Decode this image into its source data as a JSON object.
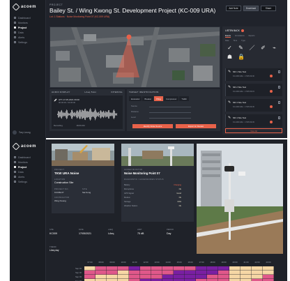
{
  "sidebar_top": {
    "brand": "acoem",
    "items": [
      {
        "label": "Dashboard",
        "active": false
      },
      {
        "label": "Monitors",
        "active": false
      },
      {
        "label": "Project",
        "active": true
      },
      {
        "label": "Data",
        "active": false
      },
      {
        "label": "Alerts",
        "active": false
      },
      {
        "label": "Settings",
        "active": false
      }
    ],
    "user": "Tony Leung"
  },
  "sidebar_bottom": {
    "brand": "acoem",
    "items": [
      {
        "label": "Dashboard",
        "active": false
      },
      {
        "label": "Monitors",
        "active": false
      },
      {
        "label": "Project",
        "active": true
      },
      {
        "label": "Data",
        "active": false
      },
      {
        "label": "Alerts",
        "active": false
      },
      {
        "label": "Settings",
        "active": false
      }
    ]
  },
  "header": {
    "crumb": "PROJECT",
    "title": "Bailey St. / Wing Kwong St. Development Project (KC-009 URA)",
    "subtitle": "Lot: 1 Stations · Noise Monitoring Point 07 (KC-009 URA)",
    "buttons": [
      "Add Note",
      "Download",
      "Share"
    ]
  },
  "audio": {
    "title": "AUDIO DISPLAY",
    "col2": "LAeq 5min",
    "col3": "INTERVAL",
    "clip_label": "ATT-17-05-2021 09:00",
    "clip_sub": "00:00:00 / 00:05:00",
    "foot_left": "Recording",
    "foot_right": "09:00 AM"
  },
  "target": {
    "title": "TARGET IDENTIFICATION",
    "tabs": [
      "Excavator",
      "Breaker",
      "Piling",
      "Compressor",
      "Traffic"
    ],
    "active_tab": 2,
    "fields": [
      "Source",
      "Distance",
      "Level"
    ],
    "buttons": [
      "Identify Noise Source",
      "Export for Review"
    ]
  },
  "listen": {
    "title": "LISTEN BACK",
    "tabs": [
      "Events",
      "Annotations",
      "Exports"
    ],
    "sub_tabs": [
      "Date",
      "Time",
      "Type"
    ],
    "tools": [
      "✓",
      "✎",
      "／",
      "✐",
      "⌁",
      "☗",
      "🔒"
    ],
    "entries": [
      {
        "title": "NR 1 Site Test",
        "sub": "KC-009 URA · 17/05 09:00"
      },
      {
        "title": "NR 2 Site Test",
        "sub": "KC-009 URA · 17/05 09:15"
      },
      {
        "title": "NR 3 Site Test",
        "sub": "KC-009 URA · 17/05 09:30"
      },
      {
        "title": "NR 4 Site Test",
        "sub": "KC-009 URA · 17/05 09:45"
      }
    ],
    "button": "View All"
  },
  "card1": {
    "k1": "PROJECT",
    "title": "TKW URA Noise",
    "k2": "LOCATION",
    "location": "Construction Site",
    "k3": "PROJECT NO.",
    "v3": "KC009-07",
    "k4": "SITE",
    "v4": "Sai Kung",
    "k5": "CONTRACTOR",
    "v5": "Wing Kwong"
  },
  "card2": {
    "k1": "ACOEM MONITOR",
    "title": "Noise Monitoring Point 07",
    "k2": "DIAGNOSTIC / ACCESSORIES STATUS",
    "rows": [
      {
        "k": "Battery",
        "v": "Charging"
      },
      {
        "k": "Microphone",
        "v": "Ok"
      },
      {
        "k": "GPS Signal",
        "v": "Good"
      },
      {
        "k": "Modem",
        "v": "Ok"
      },
      {
        "k": "Storage",
        "v": "64%"
      },
      {
        "k": "Weather Station",
        "v": "Ok"
      }
    ]
  },
  "stats": [
    {
      "k": "SITE",
      "v": "KC009"
    },
    {
      "k": "DATE",
      "v": "17/05/2021"
    },
    {
      "k": "LAEQ",
      "v": "LAeq"
    },
    {
      "k": "LIMIT",
      "v": "75 dB"
    },
    {
      "k": "PERIOD",
      "v": "Day"
    }
  ],
  "heatmap": {
    "label": "TREND",
    "title": "LAeq day",
    "rows": [
      "Sep 01",
      "Sep 02",
      "Sep 03",
      "Sep 04"
    ],
    "cols": [
      "07:00",
      "08:00",
      "09:00",
      "10:00",
      "11:00",
      "12:00",
      "13:00",
      "14:00",
      "15:00",
      "16:00",
      "17:00",
      "18:00",
      "19:00",
      "20:00",
      "21:00",
      "22:00",
      "23:00"
    ],
    "colors": {
      "low": "#f6d7a5",
      "mid": "#e0588a",
      "high": "#7a1fa2"
    }
  }
}
